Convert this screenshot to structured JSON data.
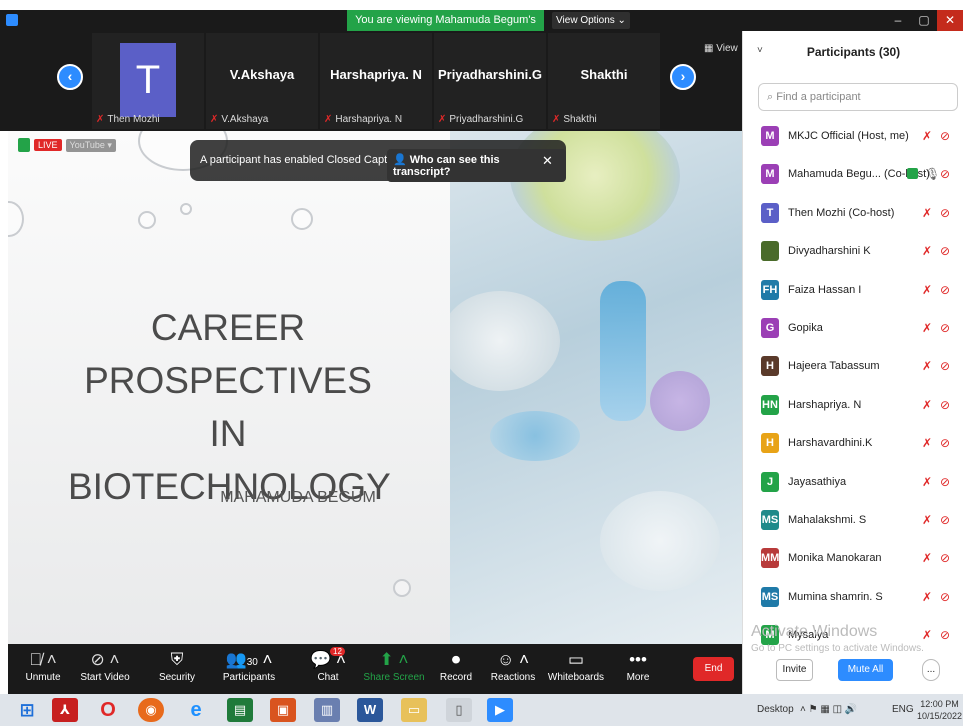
{
  "titlebar": {
    "viewing_text": "You are viewing Mahamuda Begum's screen",
    "view_options": "View Options ⌄",
    "min": "–",
    "max": "▢",
    "close": "✕"
  },
  "strip": {
    "view_label": "View",
    "thumbs": [
      {
        "name": "",
        "label": "Then Mozhi",
        "avatar_letter": "T"
      },
      {
        "name": "V.Akshaya",
        "label": "V.Akshaya"
      },
      {
        "name": "Harshapriya. N",
        "label": "Harshapriya. N"
      },
      {
        "name": "Priyadharshini.G",
        "label": "Priyadharshini.G"
      },
      {
        "name": "Shakthi",
        "label": "Shakthi"
      }
    ]
  },
  "slide": {
    "live": "LIVE",
    "youtube": "YouTube ▾",
    "notice_text": "A participant has enabled Closed Captioning",
    "notice_link": "Who can see this transcript?",
    "notice_close": "✕",
    "title_lines": [
      "CAREER",
      "PROSPECTIVES IN",
      "BIOTECHNOLOGY"
    ],
    "author": "MAHAMUDA BEGUM"
  },
  "toolbar": {
    "items": [
      {
        "label": "Unmute",
        "icon": "🎙"
      },
      {
        "label": "Start Video",
        "icon": "📹"
      },
      {
        "label": "Security",
        "icon": "🛡"
      },
      {
        "label": "Participants",
        "icon": "👥",
        "count": "30"
      },
      {
        "label": "Chat",
        "icon": "💬",
        "badge": "12"
      },
      {
        "label": "Share Screen",
        "icon": "⬆"
      },
      {
        "label": "Record",
        "icon": "⏺"
      },
      {
        "label": "Reactions",
        "icon": "😊"
      },
      {
        "label": "Whiteboards",
        "icon": "▭"
      },
      {
        "label": "More",
        "icon": "•••"
      }
    ],
    "end": "End"
  },
  "panel": {
    "title": "Participants (30)",
    "search_placeholder": "Find a participant",
    "participants": [
      {
        "initials": "M",
        "name": "MKJC Official (Host, me)",
        "color": "#9b3fb5"
      },
      {
        "initials": "M",
        "name": "Mahamuda Begu... (Co-host)",
        "color": "#9b3fb5"
      },
      {
        "initials": "T",
        "name": "Then Mozhi (Co-host)",
        "color": "#5b5fc7"
      },
      {
        "initials": "",
        "name": "Divyadharshini K",
        "color": "#4a6b2a"
      },
      {
        "initials": "FH",
        "name": "Faiza Hassan I",
        "color": "#1f7aa8"
      },
      {
        "initials": "G",
        "name": "Gopika",
        "color": "#9b3fb5"
      },
      {
        "initials": "H",
        "name": "Hajeera Tabassum",
        "color": "#5a3a2a"
      },
      {
        "initials": "HN",
        "name": "Harshapriya. N",
        "color": "#23a348"
      },
      {
        "initials": "H",
        "name": "Harshavardhini.K",
        "color": "#e8a317"
      },
      {
        "initials": "J",
        "name": "Jayasathiya",
        "color": "#23a348"
      },
      {
        "initials": "MS",
        "name": "Mahalakshmi. S",
        "color": "#1f8a8a"
      },
      {
        "initials": "MM",
        "name": "Monika Manokaran",
        "color": "#b83a3a"
      },
      {
        "initials": "MS",
        "name": "Mumina shamrin. S",
        "color": "#1f7aa8"
      },
      {
        "initials": "M",
        "name": "Mysalya",
        "color": "#23a348"
      }
    ],
    "watermark": "Activate Windows",
    "watermark_sub": "Go to PC settings to activate Windows.",
    "invite": "Invite",
    "mute_all": "Mute All",
    "more": "..."
  },
  "taskbar": {
    "desktop": "Desktop",
    "lang": "ENG",
    "time": "12:00 PM",
    "date": "10/15/2022"
  }
}
